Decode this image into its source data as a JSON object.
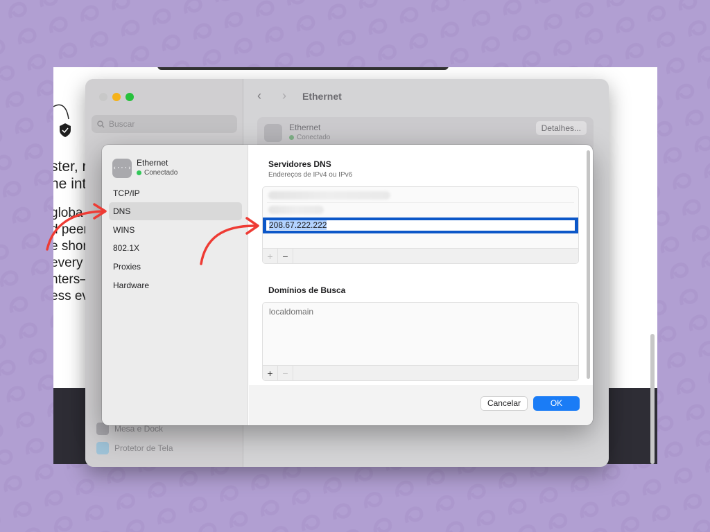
{
  "background_page": {
    "lines": [
      "ster, r",
      "ne int",
      "globa",
      "d peeri",
      "e shor",
      "every",
      "nters–",
      "ess eve"
    ]
  },
  "settings_window": {
    "search_placeholder": "Buscar",
    "title": "Ethernet",
    "card_name": "Ethernet",
    "card_status": "Conectado",
    "details_button": "Detalhes...",
    "sidebar_bottom_items": [
      "Mesa e Dock",
      "Protetor de Tela"
    ]
  },
  "sheet": {
    "interface_name": "Ethernet",
    "interface_status": "Conectado",
    "tabs": [
      "TCP/IP",
      "DNS",
      "WINS",
      "802.1X",
      "Proxies",
      "Hardware"
    ],
    "selected_tab": "DNS",
    "dns_section": {
      "title": "Servidores DNS",
      "subtitle": "Endereços de IPv4 ou IPv6",
      "editing_value": "208.67.222.222"
    },
    "search_domains_section": {
      "title": "Domínios de Busca",
      "items": [
        "localdomain"
      ]
    },
    "toolbar": {
      "add": "+",
      "remove": "−"
    },
    "buttons": {
      "cancel": "Cancelar",
      "ok": "OK"
    }
  },
  "colors": {
    "background": "#b19fd2",
    "accent_blue": "#1a7cf6",
    "focus_ring": "#0c57c8",
    "connected_green": "#32c759",
    "annotation_arrow": "#ee3b34"
  }
}
